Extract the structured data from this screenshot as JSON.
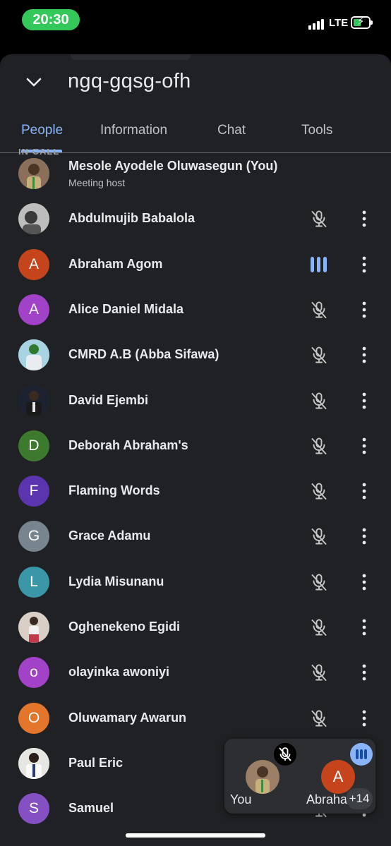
{
  "status_bar": {
    "time": "20:30",
    "network": "LTE"
  },
  "header": {
    "meeting_code": "ngq-gqsg-ofh"
  },
  "tabs": [
    {
      "label": "People",
      "active": true
    },
    {
      "label": "Information",
      "active": false
    },
    {
      "label": "Chat",
      "active": false
    },
    {
      "label": "Tools",
      "active": false
    }
  ],
  "section_label": "IN CALL",
  "participants": [
    {
      "name": "Mesole Ayodele Oluwasegun (You)",
      "subtitle": "Meeting host",
      "avatar": "photo",
      "avatar_color": "#8a6f5a",
      "status": "none"
    },
    {
      "name": "Abdulmujib Babalola",
      "avatar": "photo",
      "avatar_color": "#8e8e8e",
      "status": "muted"
    },
    {
      "name": "Abraham Agom",
      "avatar": "A",
      "avatar_color": "#c5441b",
      "status": "speaking"
    },
    {
      "name": "Alice Daniel Midala",
      "avatar": "A",
      "avatar_color": "#a142c9",
      "status": "muted"
    },
    {
      "name": "CMRD A.B (Abba Sifawa)",
      "avatar": "photo",
      "avatar_color": "#9cc6d8",
      "status": "muted"
    },
    {
      "name": "David Ejembi",
      "avatar": "photo",
      "avatar_color": "#2e3340",
      "status": "muted"
    },
    {
      "name": "Deborah Abraham's",
      "avatar": "D",
      "avatar_color": "#3d7a2e",
      "status": "muted"
    },
    {
      "name": "Flaming Words",
      "avatar": "F",
      "avatar_color": "#5b34b0",
      "status": "muted"
    },
    {
      "name": "Grace Adamu",
      "avatar": "G",
      "avatar_color": "#79858e",
      "status": "muted"
    },
    {
      "name": "Lydia Misunanu",
      "avatar": "L",
      "avatar_color": "#3a97a8",
      "status": "muted"
    },
    {
      "name": "Oghenekeno Egidi",
      "avatar": "photo",
      "avatar_color": "#cbb9ad",
      "status": "muted"
    },
    {
      "name": "olayinka awoniyi",
      "avatar": "o",
      "avatar_color": "#a142c9",
      "status": "muted"
    },
    {
      "name": "Oluwamary Awarun",
      "avatar": "O",
      "avatar_color": "#e3762b",
      "status": "muted"
    },
    {
      "name": "Paul Eric",
      "avatar": "photo",
      "avatar_color": "#d7d7d2",
      "status": "muted"
    },
    {
      "name": "Samuel",
      "avatar": "S",
      "avatar_color": "#8450c4",
      "status": "muted"
    }
  ],
  "pip": {
    "you_label": "You",
    "other_label": "Abraham",
    "other_initial": "A",
    "more_count": "+14"
  },
  "colors": {
    "accent": "#8ab4f8",
    "panel": "#202124",
    "status_green": "#34c759"
  }
}
